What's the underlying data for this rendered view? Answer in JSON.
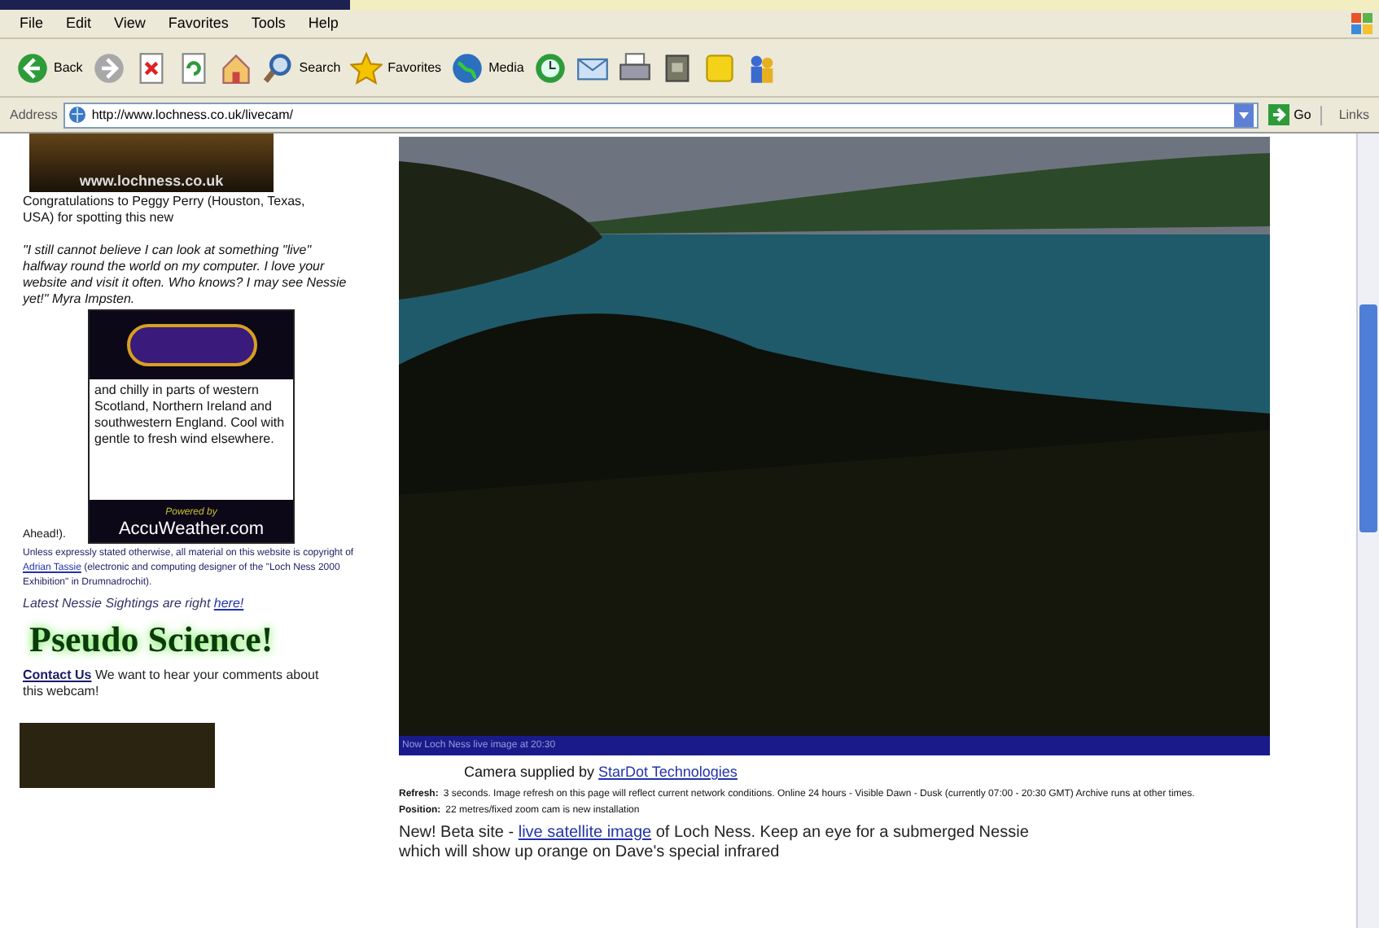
{
  "menu": [
    "File",
    "Edit",
    "View",
    "Favorites",
    "Tools",
    "Help"
  ],
  "toolbar": [
    {
      "kind": "back",
      "label": "Back"
    },
    {
      "kind": "forward"
    },
    {
      "kind": "stop"
    },
    {
      "kind": "refresh"
    },
    {
      "kind": "home"
    },
    {
      "kind": "search",
      "label": "Search"
    },
    {
      "kind": "favorites",
      "label": "Favorites"
    },
    {
      "kind": "media",
      "label": "Media"
    },
    {
      "kind": "history"
    },
    {
      "kind": "mail"
    },
    {
      "kind": "print"
    },
    {
      "kind": "edit"
    },
    {
      "kind": "note"
    },
    {
      "kind": "messenger"
    }
  ],
  "address": {
    "label": "Address",
    "value": "http://www.lochness.co.uk/livecam/",
    "go": "Go",
    "links": "Links"
  },
  "sidebar": {
    "logo_text": "www.lochness.co.uk",
    "congrats": "Congratulations to Peggy Perry (Houston, Texas, USA) for spotting this new",
    "quote": "\"I still cannot believe I can look at something \"live\" halfway round the world on my computer. I love your website and visit it often. Who knows? I may see Nessie yet!\" Myra Impsten.",
    "weather": {
      "text": "and chilly in parts of western Scotland, Northern Ireland and southwestern England. Cool with gentle to fresh wind elsewhere.",
      "powered": "Powered by",
      "brand": "AccuWeather.com"
    },
    "ahead": "Ahead!).",
    "copyright": {
      "before": "Unless expressly stated otherwise, all material on this website is copyright of ",
      "link": "Adrian Tassie",
      "after": " (electronic and computing designer of the \"Loch Ness 2000 Exhibition\" in Drumnadrochit)."
    },
    "sightings": {
      "text": "Latest Nessie Sightings are right ",
      "link": "here!"
    },
    "banner": "Pseudo Science!",
    "contact": {
      "link": "Contact Us",
      "text": " We want to hear your comments about this webcam!"
    }
  },
  "webcam": {
    "caption": "Now Loch Ness live image at 20:30"
  },
  "camera": {
    "text": "Camera supplied by ",
    "link": "StarDot Technologies"
  },
  "details": [
    {
      "label": "Refresh:",
      "text": "3 seconds. Image refresh on this page will reflect current network conditions. Online 24 hours - Visible Dawn - Dusk (currently 07:00 - 20:30 GMT) Archive runs at other times."
    },
    {
      "label": "Position:",
      "text": "22 metres/fixed zoom cam is new installation"
    }
  ],
  "beta": {
    "before": "New! Beta site - ",
    "link": "live satellite image",
    "after": " of Loch Ness.  Keep an eye for a submerged Nessie which will show up orange on Dave's special infrared"
  }
}
